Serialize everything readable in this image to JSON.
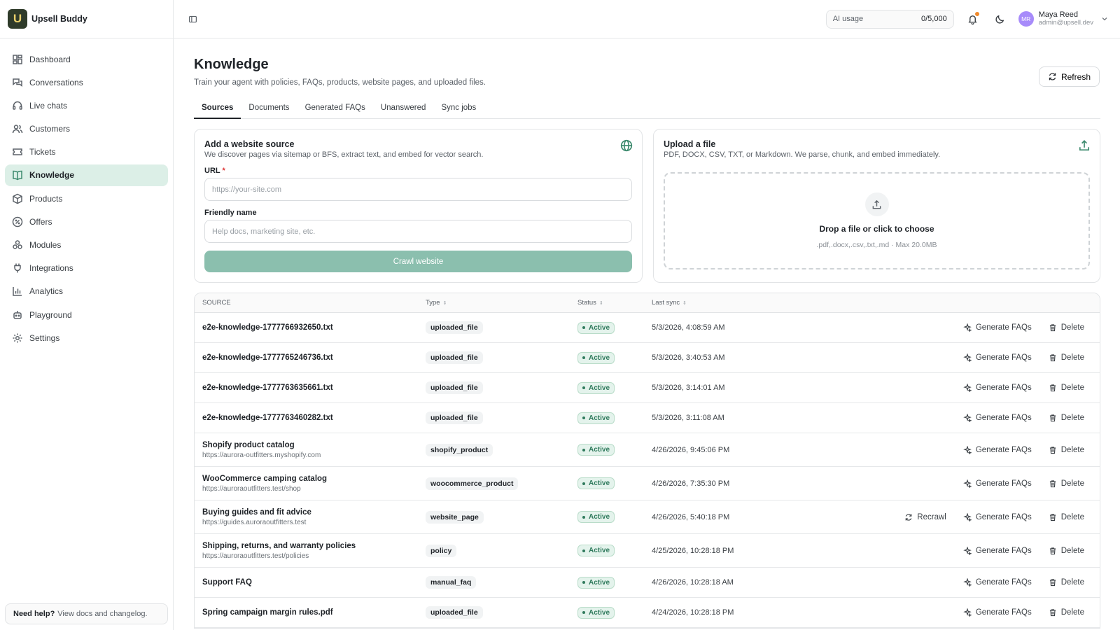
{
  "brand": {
    "name": "Upsell Buddy",
    "logo_letter": "U"
  },
  "sidebar": {
    "items": [
      {
        "label": "Dashboard",
        "icon": "grid-icon"
      },
      {
        "label": "Conversations",
        "icon": "chat-icon"
      },
      {
        "label": "Live chats",
        "icon": "headset-icon"
      },
      {
        "label": "Customers",
        "icon": "users-icon"
      },
      {
        "label": "Tickets",
        "icon": "ticket-icon"
      },
      {
        "label": "Knowledge",
        "icon": "book-icon",
        "active": true
      },
      {
        "label": "Products",
        "icon": "box-icon"
      },
      {
        "label": "Offers",
        "icon": "tag-icon"
      },
      {
        "label": "Modules",
        "icon": "modules-icon"
      },
      {
        "label": "Integrations",
        "icon": "plug-icon"
      },
      {
        "label": "Analytics",
        "icon": "chart-icon"
      },
      {
        "label": "Playground",
        "icon": "robot-icon"
      },
      {
        "label": "Settings",
        "icon": "gear-icon"
      }
    ],
    "help": {
      "title": "Need help?",
      "text": "View docs and changelog."
    }
  },
  "topbar": {
    "ai_usage_label": "AI usage",
    "ai_usage_value": "0/5,000",
    "user": {
      "initials": "MR",
      "name": "Maya Reed",
      "email": "admin@upsell.dev"
    }
  },
  "page": {
    "title": "Knowledge",
    "subtitle": "Train your agent with policies, FAQs, products, website pages, and uploaded files.",
    "refresh_label": "Refresh"
  },
  "tabs": [
    "Sources",
    "Documents",
    "Generated FAQs",
    "Unanswered",
    "Sync jobs"
  ],
  "website_card": {
    "title": "Add a website source",
    "desc": "We discover pages via sitemap or BFS, extract text, and embed for vector search.",
    "url_label": "URL",
    "url_required": "*",
    "url_placeholder": "https://your-site.com",
    "name_label": "Friendly name",
    "name_placeholder": "Help docs, marketing site, etc.",
    "button": "Crawl website"
  },
  "upload_card": {
    "title": "Upload a file",
    "desc": "PDF, DOCX, CSV, TXT, or Markdown. We parse, chunk, and embed immediately.",
    "drop_title": "Drop a file or click to choose",
    "drop_sub": ".pdf,.docx,.csv,.txt,.md · Max 20.0MB"
  },
  "table": {
    "headers": {
      "source": "SOURCE",
      "type": "Type",
      "status": "Status",
      "last_sync": "Last sync"
    },
    "actions": {
      "recrawl": "Recrawl",
      "generate": "Generate FAQs",
      "delete": "Delete"
    },
    "rows": [
      {
        "name": "e2e-knowledge-1777766932650.txt",
        "url": "",
        "type": "uploaded_file",
        "status": "Active",
        "date": "5/3/2026, 4:08:59 AM",
        "recrawl": false
      },
      {
        "name": "e2e-knowledge-1777765246736.txt",
        "url": "",
        "type": "uploaded_file",
        "status": "Active",
        "date": "5/3/2026, 3:40:53 AM",
        "recrawl": false
      },
      {
        "name": "e2e-knowledge-1777763635661.txt",
        "url": "",
        "type": "uploaded_file",
        "status": "Active",
        "date": "5/3/2026, 3:14:01 AM",
        "recrawl": false
      },
      {
        "name": "e2e-knowledge-1777763460282.txt",
        "url": "",
        "type": "uploaded_file",
        "status": "Active",
        "date": "5/3/2026, 3:11:08 AM",
        "recrawl": false
      },
      {
        "name": "Shopify product catalog",
        "url": "https://aurora-outfitters.myshopify.com",
        "type": "shopify_product",
        "status": "Active",
        "date": "4/26/2026, 9:45:06 PM",
        "recrawl": false
      },
      {
        "name": "WooCommerce camping catalog",
        "url": "https://auroraoutfitters.test/shop",
        "type": "woocommerce_product",
        "status": "Active",
        "date": "4/26/2026, 7:35:30 PM",
        "recrawl": false
      },
      {
        "name": "Buying guides and fit advice",
        "url": "https://guides.auroraoutfitters.test",
        "type": "website_page",
        "status": "Active",
        "date": "4/26/2026, 5:40:18 PM",
        "recrawl": true
      },
      {
        "name": "Shipping, returns, and warranty policies",
        "url": "https://auroraoutfitters.test/policies",
        "type": "policy",
        "status": "Active",
        "date": "4/25/2026, 10:28:18 PM",
        "recrawl": false
      },
      {
        "name": "Support FAQ",
        "url": "",
        "type": "manual_faq",
        "status": "Active",
        "date": "4/26/2026, 10:28:18 AM",
        "recrawl": false
      },
      {
        "name": "Spring campaign margin rules.pdf",
        "url": "",
        "type": "uploaded_file",
        "status": "Active",
        "date": "4/24/2026, 10:28:18 PM",
        "recrawl": false
      }
    ]
  }
}
